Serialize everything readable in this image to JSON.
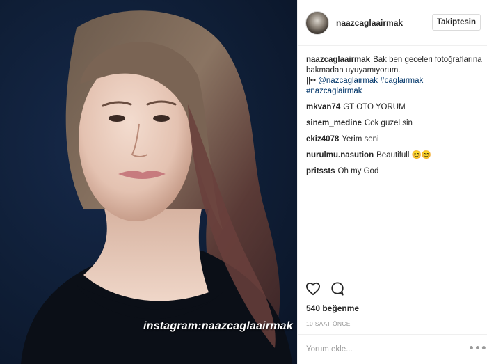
{
  "photo": {
    "watermark": "instagram:naazcaglaairmak"
  },
  "header": {
    "username": "naazcaglaairmak",
    "follow_label": "Takiptesin"
  },
  "caption": {
    "user": "naazcaglaairmak",
    "text": "Bak ben geceleri fotoğraflarına bakmadan uyuyamıyorum.",
    "separator": "||••",
    "mention": "@nazcaglairmak",
    "hashtag1": "#caglairmak",
    "hashtag2": "#nazcaglairmak"
  },
  "comments": [
    {
      "user": "mkvan74",
      "text": "GT OTO YORUM"
    },
    {
      "user": "sinem_medine",
      "text": "Cok guzel sin"
    },
    {
      "user": "ekiz4078",
      "text": "Yerim seni"
    },
    {
      "user": "nurulmu.nasution",
      "text": "Beautifull 😊😊"
    },
    {
      "user": "pritssts",
      "text": "Oh my God"
    }
  ],
  "actions": {
    "like_icon": "heart-icon",
    "comment_icon": "comment-bubble-icon"
  },
  "likes": "540 beğenme",
  "timestamp": "10 SAAT ÖNCE",
  "add_comment": {
    "placeholder": "Yorum ekle...",
    "more_symbol": "•••"
  },
  "colors": {
    "photo_background": "#0f1e36",
    "link": "#003569",
    "muted": "#999999",
    "text": "#262626"
  }
}
